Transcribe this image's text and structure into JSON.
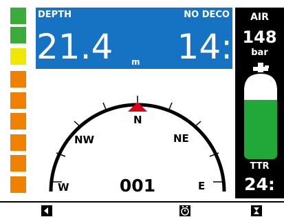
{
  "ascent_bar": {
    "segments": [
      "#3aac3a",
      "#3aac3a",
      "#f0e800",
      "#f08000",
      "#f08000",
      "#f08000",
      "#f08000",
      "#f08000",
      "#f08000",
      "#f08000"
    ]
  },
  "depth": {
    "label": "DEPTH",
    "value": "21.4",
    "unit": "m"
  },
  "no_deco": {
    "label": "NO DECO",
    "value": "14:"
  },
  "compass": {
    "heading": "001",
    "labels": {
      "n": "N",
      "ne": "NE",
      "nw": "NW",
      "e": "E",
      "w": "W"
    },
    "marker_color": "#e0001a"
  },
  "air": {
    "label": "AIR",
    "value": "148",
    "unit": "bar",
    "tank_color": "#20a838"
  },
  "ttr": {
    "label": "TTR",
    "value": "24:"
  },
  "buttons": {
    "left_icon": "back-icon",
    "middle_icon": "compass-dial-icon",
    "right_icon": "hourglass-icon"
  },
  "colors": {
    "blue_panel": "#1673c4",
    "green": "#3aac3a",
    "yellow": "#f0e800",
    "orange": "#f08000"
  }
}
